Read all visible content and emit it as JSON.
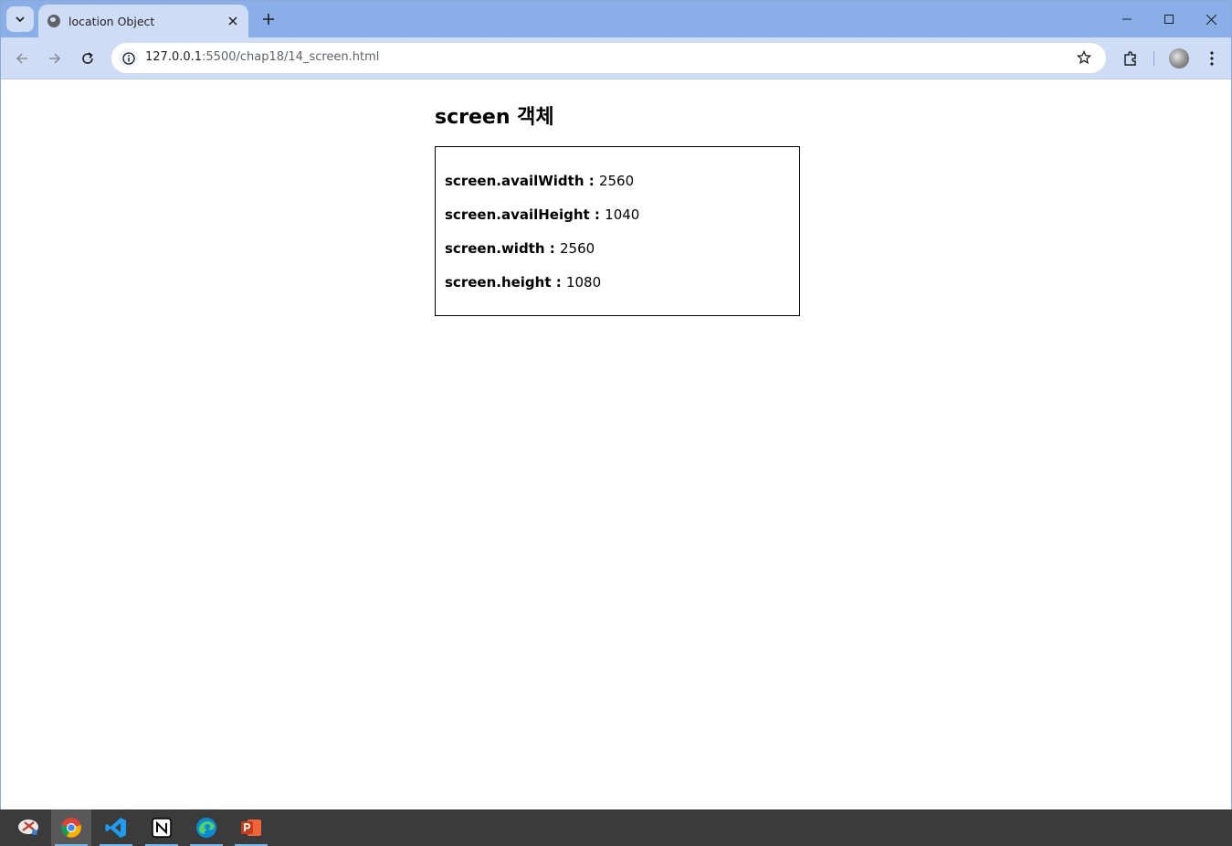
{
  "browser": {
    "tab_title": "location Object",
    "url_host": "127.0.0.1",
    "url_rest": ":5500/chap18/14_screen.html"
  },
  "page": {
    "title": "screen 객체",
    "rows": [
      {
        "key": "screen.availWidth : ",
        "value": "2560"
      },
      {
        "key": "screen.availHeight : ",
        "value": "1040"
      },
      {
        "key": "screen.width : ",
        "value": "2560"
      },
      {
        "key": "screen.height : ",
        "value": "1080"
      }
    ]
  },
  "taskbar": {
    "apps": [
      "snipping-tool",
      "chrome",
      "vscode",
      "notion",
      "edge",
      "powerpoint"
    ]
  },
  "colors": {
    "tabstrip": "#8aaee8",
    "toolbar": "#cfdcf5",
    "taskbar": "#3b3b3b"
  }
}
